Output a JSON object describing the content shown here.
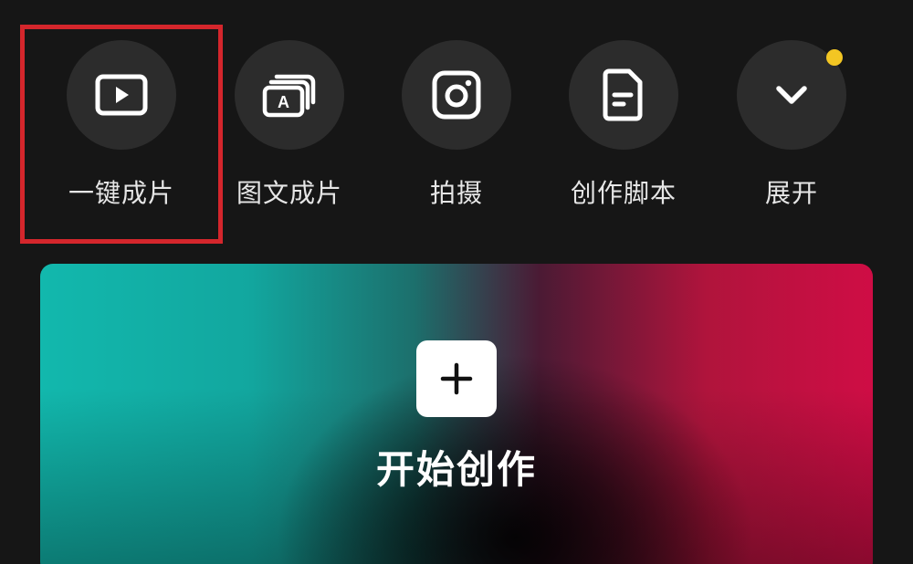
{
  "tools": [
    {
      "label": "一键成片",
      "icon": "play-video-icon"
    },
    {
      "label": "图文成片",
      "icon": "text-to-video-icon"
    },
    {
      "label": "拍摄",
      "icon": "camera-icon"
    },
    {
      "label": "创作脚本",
      "icon": "script-document-icon"
    },
    {
      "label": "展开",
      "icon": "chevron-down-icon",
      "badge": "notification-dot"
    }
  ],
  "create": {
    "label": "开始创作",
    "icon": "plus-icon"
  },
  "colors": {
    "background": "#161616",
    "tool_circle": "#2c2c2c",
    "highlight_border": "#d4262c",
    "badge": "#f3c623",
    "gradient_left": "#12b8ad",
    "gradient_right": "#cf0d45"
  }
}
